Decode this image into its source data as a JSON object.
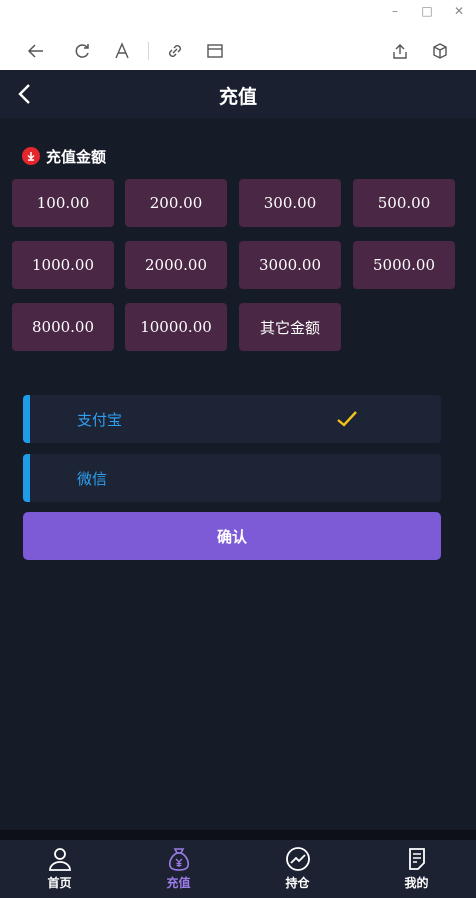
{
  "window_controls": {
    "minimize": "–",
    "maximize": "□",
    "close": "✕"
  },
  "toolbar_icons": [
    "back-icon",
    "refresh-icon",
    "read-aloud-icon",
    "link-icon",
    "window-icon",
    "share-icon",
    "cube-icon"
  ],
  "header": {
    "title": "充值"
  },
  "recharge": {
    "section_title": "充值金额",
    "amounts": [
      "100.00",
      "200.00",
      "300.00",
      "500.00",
      "1000.00",
      "2000.00",
      "3000.00",
      "5000.00",
      "8000.00",
      "10000.00",
      "其它金额"
    ]
  },
  "payment": {
    "methods": [
      {
        "label": "支付宝",
        "selected": true
      },
      {
        "label": "微信",
        "selected": false
      }
    ],
    "accent_color": "#1e9be9",
    "check_color": "#f5c21b"
  },
  "confirm_label": "确认",
  "tabbar": {
    "items": [
      {
        "label": "首页",
        "icon": "user-icon",
        "active": false
      },
      {
        "label": "充值",
        "icon": "money-bag-icon",
        "active": true
      },
      {
        "label": "持仓",
        "icon": "chart-icon",
        "active": false
      },
      {
        "label": "我的",
        "icon": "document-icon",
        "active": false
      }
    ]
  },
  "colors": {
    "background": "#151b27",
    "amount_bg": "#4a2744",
    "confirm_bg": "#7e5bd6",
    "active_tab": "#9b7be6"
  }
}
